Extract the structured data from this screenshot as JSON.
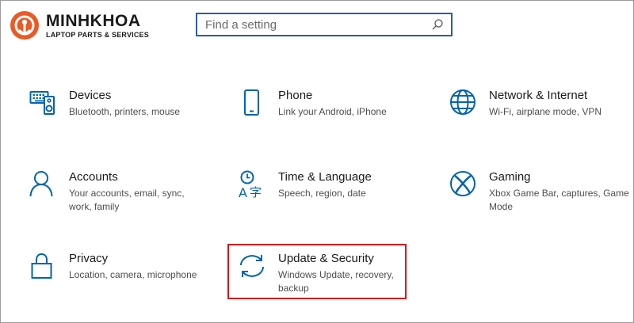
{
  "brand": {
    "name": "MINHKHOA",
    "tagline": "LAPTOP PARTS & SERVICES"
  },
  "search": {
    "placeholder": "Find a setting",
    "value": ""
  },
  "colors": {
    "accent": "#0063b1",
    "search_border": "#2b5bab",
    "logo_orange": "#ea5a24",
    "highlight": "#d9141b"
  },
  "tiles": [
    {
      "title": "Devices",
      "description": "Bluetooth, printers, mouse",
      "icon": "keyboard-speaker-icon"
    },
    {
      "title": "Phone",
      "description": "Link your Android, iPhone",
      "icon": "phone-icon"
    },
    {
      "title": "Network & Internet",
      "description": "Wi-Fi, airplane mode, VPN",
      "icon": "globe-icon"
    },
    {
      "title": "Accounts",
      "description": "Your accounts, email, sync, work, family",
      "icon": "person-icon"
    },
    {
      "title": "Time & Language",
      "description": "Speech, region, date",
      "icon": "time-language-icon"
    },
    {
      "title": "Gaming",
      "description": "Xbox Game Bar, captures, Game Mode",
      "icon": "xbox-icon"
    },
    {
      "title": "Privacy",
      "description": "Location, camera, microphone",
      "icon": "lock-icon"
    },
    {
      "title": "Update & Security",
      "description": "Windows Update, recovery, backup",
      "icon": "sync-icon"
    }
  ]
}
